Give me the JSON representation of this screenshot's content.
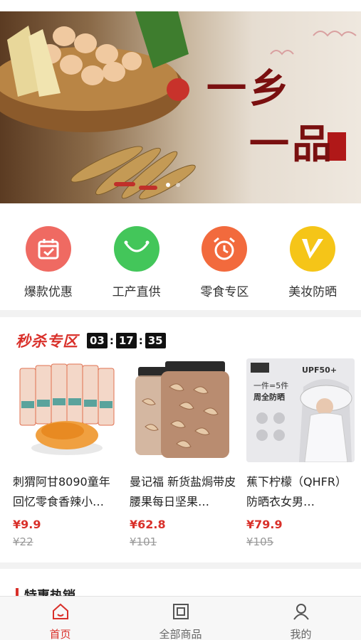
{
  "banner": {
    "title_line1": "一乡",
    "title_line2": "一品"
  },
  "categories": [
    {
      "label": "爆款优惠",
      "icon": "calendar-check-icon",
      "color": "#ef6a62"
    },
    {
      "label": "工产直供",
      "icon": "smile-icon",
      "color": "#43c65a"
    },
    {
      "label": "零食专区",
      "icon": "alarm-clock-icon",
      "color": "#f26a3d"
    },
    {
      "label": "美妆防晒",
      "icon": "v-icon",
      "color": "#f5c518"
    }
  ],
  "flash_sale": {
    "title": "秒杀专区",
    "timer": {
      "hours": "03",
      "minutes": "17",
      "seconds": "35"
    },
    "products": [
      {
        "name": "刺猬阿甘8090童年回忆零食香辣小…",
        "price": "¥9.9",
        "old_price": "¥22"
      },
      {
        "name": "曼记福 新货盐焗带皮腰果每日坚果…",
        "price": "¥62.8",
        "old_price": "¥101"
      },
      {
        "name": "蕉下柠檬（QHFR）防晒衣女男…",
        "price": "¥79.9",
        "old_price": "¥105",
        "image_text": {
          "badge": "UPF50+",
          "promo": "一件=5件",
          "promo2": "周全防晒"
        }
      }
    ]
  },
  "hot_section": {
    "title": "特惠热销"
  },
  "tabbar": [
    {
      "label": "首页",
      "icon": "home-icon",
      "active": true
    },
    {
      "label": "全部商品",
      "icon": "grid-icon",
      "active": false
    },
    {
      "label": "我的",
      "icon": "user-icon",
      "active": false
    }
  ],
  "colors": {
    "accent": "#d9302a"
  }
}
